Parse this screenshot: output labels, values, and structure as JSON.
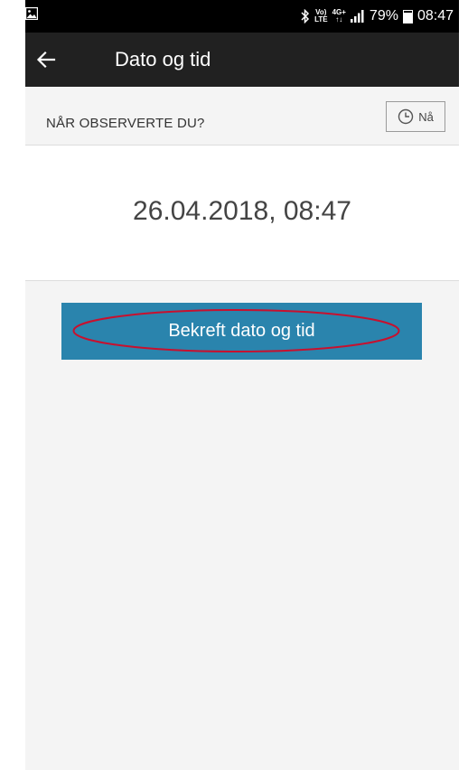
{
  "status_bar": {
    "battery": "79%",
    "time": "08:47",
    "network_top": "Vo)",
    "network_bottom": "LTE",
    "signal_top": "4G+",
    "signal_bottom": "↑↓",
    "battery_level": 0.79
  },
  "app_bar": {
    "title": "Dato og tid"
  },
  "section": {
    "label": "NÅR OBSERVERTE DU?",
    "now_button_label": "Nå"
  },
  "datetime": {
    "value": "26.04.2018, 08:47"
  },
  "confirm_button": {
    "label": "Bekreft dato og tid"
  },
  "colors": {
    "status_bar_bg": "#000000",
    "app_bar_bg": "#212121",
    "accent": "#2a84ad",
    "annotation": "#c8102e",
    "background": "#f4f4f4"
  }
}
